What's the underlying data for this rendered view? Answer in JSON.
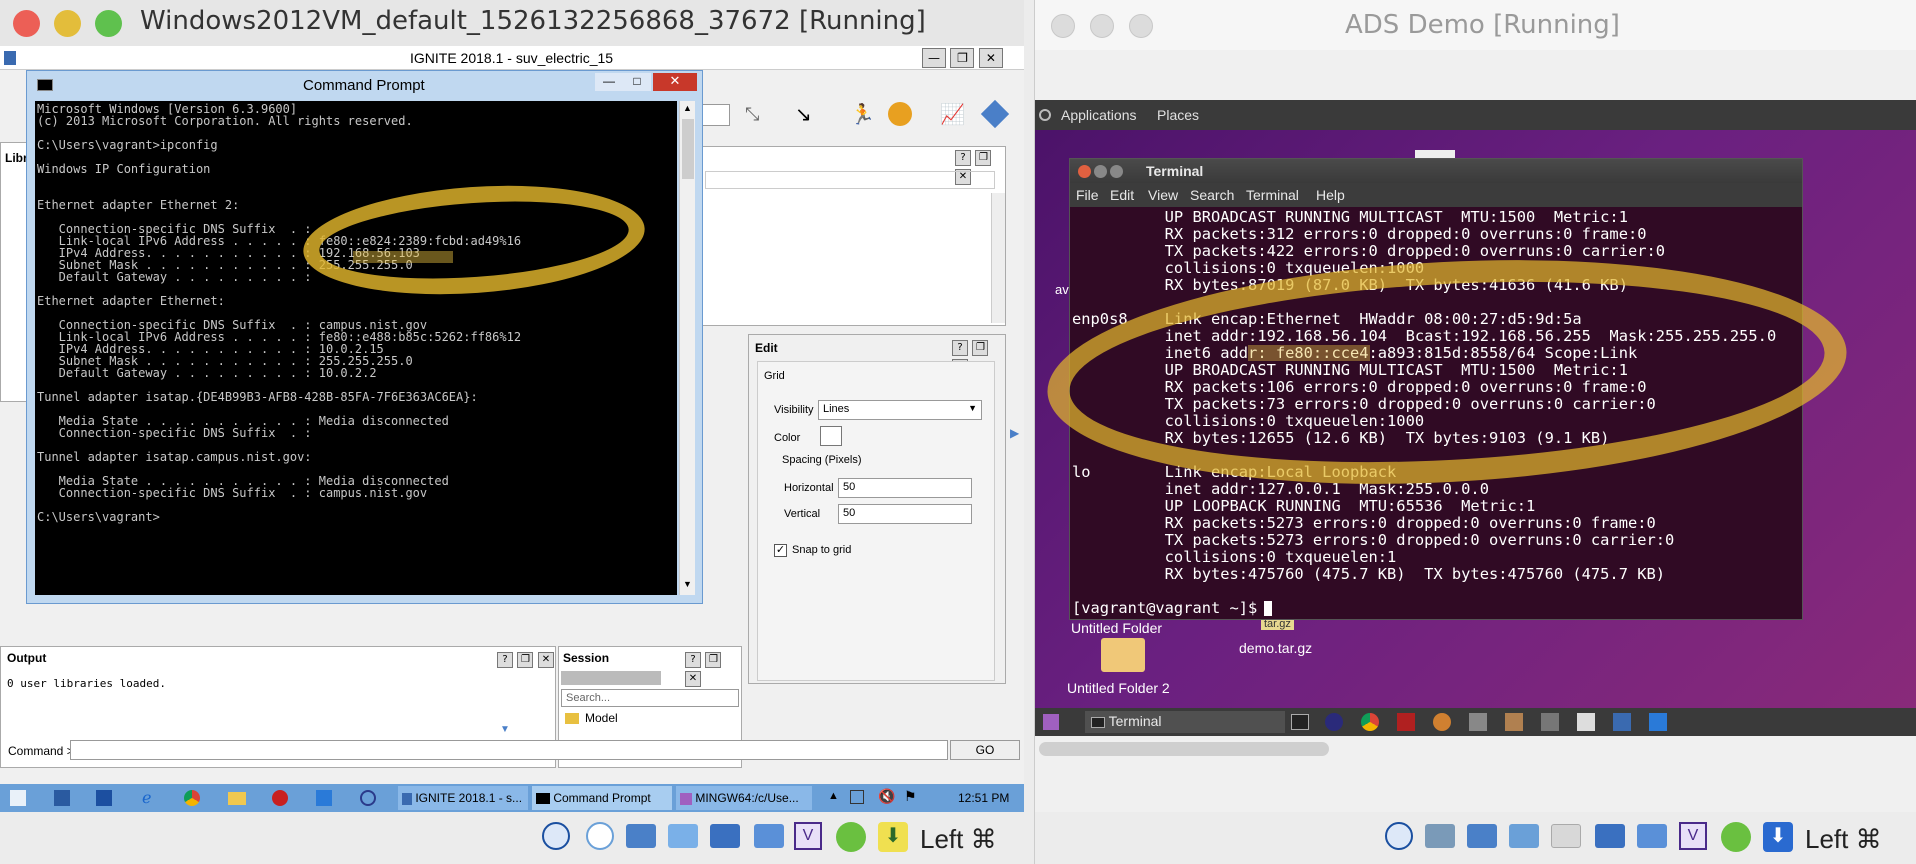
{
  "vm_left": {
    "title": "Windows2012VM_default_1526132256868_37672 [Running]",
    "host_key": "Left ⌘"
  },
  "vm_right": {
    "title": "ADS Demo [Running]",
    "host_key": "Left ⌘"
  },
  "ignite": {
    "title": "IGNITE 2018.1 - suv_electric_15",
    "lib_tab": "Libr",
    "search_placeholder": "Sear",
    "edit_panel": {
      "title": "Edit",
      "group": "Grid",
      "visibility_label": "Visibility",
      "visibility_value": "Lines",
      "color_label": "Color",
      "spacing_label": "Spacing (Pixels)",
      "horizontal_label": "Horizontal",
      "horizontal_value": "50",
      "vertical_label": "Vertical",
      "vertical_value": "50",
      "snap_label": "Snap to grid"
    },
    "output": {
      "title": "Output",
      "text": "0 user libraries loaded."
    },
    "session": {
      "title": "Session",
      "search_placeholder": "Search...",
      "item": "Model"
    },
    "command_label": "Command >",
    "go_label": "GO"
  },
  "cmd": {
    "title": "Command Prompt",
    "lines": [
      "Microsoft Windows [Version 6.3.9600]",
      "(c) 2013 Microsoft Corporation. All rights reserved.",
      "",
      "C:\\Users\\vagrant>ipconfig",
      "",
      "Windows IP Configuration",
      "",
      "",
      "Ethernet adapter Ethernet 2:",
      "",
      "   Connection-specific DNS Suffix  . :",
      "   Link-local IPv6 Address . . . . . : fe80::e824:2389:fcbd:ad49%16",
      "   IPv4 Address. . . . . . . . . . . : 192.168.56.103",
      "   Subnet Mask . . . . . . . . . . . : 255.255.255.0",
      "   Default Gateway . . . . . . . . . :",
      "",
      "Ethernet adapter Ethernet:",
      "",
      "   Connection-specific DNS Suffix  . : campus.nist.gov",
      "   Link-local IPv6 Address . . . . . : fe80::e488:b85c:5262:ff86%12",
      "   IPv4 Address. . . . . . . . . . . : 10.0.2.15",
      "   Subnet Mask . . . . . . . . . . . : 255.255.255.0",
      "   Default Gateway . . . . . . . . . : 10.0.2.2",
      "",
      "Tunnel adapter isatap.{DE4B99B3-AFB8-428B-85FA-7F6E363AC6EA}:",
      "",
      "   Media State . . . . . . . . . . . : Media disconnected",
      "   Connection-specific DNS Suffix  . :",
      "",
      "Tunnel adapter isatap.campus.nist.gov:",
      "",
      "   Media State . . . . . . . . . . . : Media disconnected",
      "   Connection-specific DNS Suffix  . : campus.nist.gov",
      "",
      "C:\\Users\\vagrant>"
    ]
  },
  "win_taskbar": {
    "items": [
      "IGNITE 2018.1 - s...",
      "Command Prompt",
      "MINGW64:/c/Use..."
    ],
    "time": "12:51 PM"
  },
  "gnome": {
    "menu": [
      "Applications",
      "Places"
    ],
    "desktop_items": [
      "Untitled Folder",
      "demo.tar.gz",
      "Untitled Folder 2"
    ],
    "tooltip": "tar.gz",
    "taskbar_item": "Terminal",
    "left_label": "av"
  },
  "terminal": {
    "title": "Terminal",
    "menu": [
      "File",
      "Edit",
      "View",
      "Search",
      "Terminal",
      "Help"
    ],
    "lines": [
      "          UP BROADCAST RUNNING MULTICAST  MTU:1500  Metric:1",
      "          RX packets:312 errors:0 dropped:0 overruns:0 frame:0",
      "          TX packets:422 errors:0 dropped:0 overruns:0 carrier:0",
      "          collisions:0 txqueuelen:1000",
      "          RX bytes:87019 (87.0 KB)  TX bytes:41636 (41.6 KB)",
      "",
      "enp0s8    Link encap:Ethernet  HWaddr 08:00:27:d5:9d:5a",
      "          inet addr:192.168.56.104  Bcast:192.168.56.255  Mask:255.255.255.0",
      "          inet6 addr: fe80::cce4:a893:815d:8558/64 Scope:Link",
      "          UP BROADCAST RUNNING MULTICAST  MTU:1500  Metric:1",
      "          RX packets:106 errors:0 dropped:0 overruns:0 frame:0",
      "          TX packets:73 errors:0 dropped:0 overruns:0 carrier:0",
      "          collisions:0 txqueuelen:1000",
      "          RX bytes:12655 (12.6 KB)  TX bytes:9103 (9.1 KB)",
      "",
      "lo        Link encap:Local Loopback",
      "          inet addr:127.0.0.1  Mask:255.0.0.0",
      "          UP LOOPBACK RUNNING  MTU:65536  Metric:1",
      "          RX packets:5273 errors:0 dropped:0 overruns:0 frame:0",
      "          TX packets:5273 errors:0 dropped:0 overruns:0 carrier:0",
      "          collisions:0 txqueuelen:1",
      "          RX bytes:475760 (475.7 KB)  TX bytes:475760 (475.7 KB)",
      "",
      "[vagrant@vagrant ~]$ "
    ]
  },
  "colors": {
    "highlight": "#e8c040",
    "gnome_desktop": "#5a1a72",
    "cmd_bg": "#000000",
    "terminal_bg": "#300a24"
  }
}
